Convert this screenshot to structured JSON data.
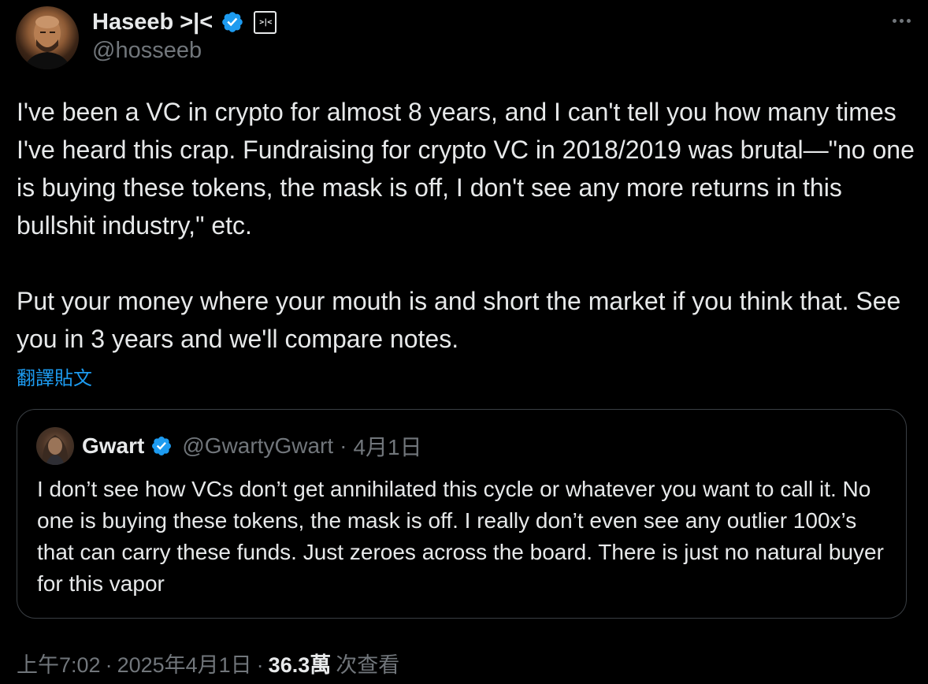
{
  "author": {
    "display_name": "Haseeb >|<",
    "handle": "@hosseeb",
    "affiliate_badge_text": ">|<",
    "verified_color": "#1d9bf0",
    "avatar_icon": "profile-photo"
  },
  "tweet": {
    "text": "I've been a VC in crypto for almost 8 years, and I can't tell you how many times I've heard this crap. Fundraising for crypto VC in 2018/2019 was brutal—\"no one is buying these tokens, the mask is off, I don't see any more returns in this bullshit industry,\" etc.\n\nPut your money where your mouth is and short the market if you think that. See you in 3 years and we'll compare notes.",
    "translate_label": "翻譯貼文"
  },
  "quoted_tweet": {
    "display_name": "Gwart",
    "handle": "@GwartyGwart",
    "separator": "·",
    "date": "4月1日",
    "text": "I don’t see how VCs don’t get annihilated this cycle or whatever you want to call it. No one is buying these tokens, the mask is off. I really don’t even see any outlier 100x’s that can carry these funds. Just zeroes across the board. There is just no natural buyer for this vapor"
  },
  "meta": {
    "time": "上午7:02",
    "separator": "·",
    "date": "2025年4月1日",
    "views_count": "36.3萬",
    "views_label": "次查看"
  },
  "colors": {
    "background": "#000000",
    "text_primary": "#e7e9ea",
    "text_secondary": "#71767b",
    "accent": "#1d9bf0",
    "border": "#3a3f44"
  }
}
